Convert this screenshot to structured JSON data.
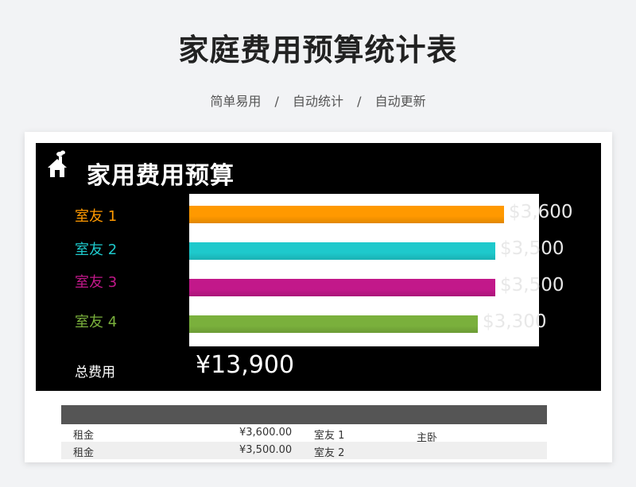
{
  "header": {
    "title": "家庭费用预算统计表",
    "features": [
      "简单易用",
      "自动统计",
      "自动更新"
    ],
    "separator": "/"
  },
  "panel": {
    "title": "家用费用预算",
    "total_label": "总费用",
    "total_value": "¥13,900"
  },
  "colors": {
    "roommate1": "#ff9900",
    "roommate2": "#1ec9cc",
    "roommate3": "#c2188a",
    "roommate4": "#7ab03c"
  },
  "chart_data": {
    "type": "bar",
    "orientation": "horizontal",
    "categories": [
      "室友 1",
      "室友 2",
      "室友 3",
      "室友 4"
    ],
    "values": [
      3600,
      3500,
      3500,
      3300
    ],
    "value_labels": [
      "$3,600",
      "$3,500",
      "$3,500",
      "$3,300"
    ],
    "xlim": [
      0,
      4000
    ],
    "grid": false,
    "legend": "none"
  },
  "table": {
    "rows": [
      {
        "category": "租金",
        "amount": "¥3,600.00",
        "roommate": "室友 1",
        "note": "主卧"
      },
      {
        "category": "租金",
        "amount": "¥3,500.00",
        "roommate": "室友 2",
        "note": ""
      }
    ]
  }
}
